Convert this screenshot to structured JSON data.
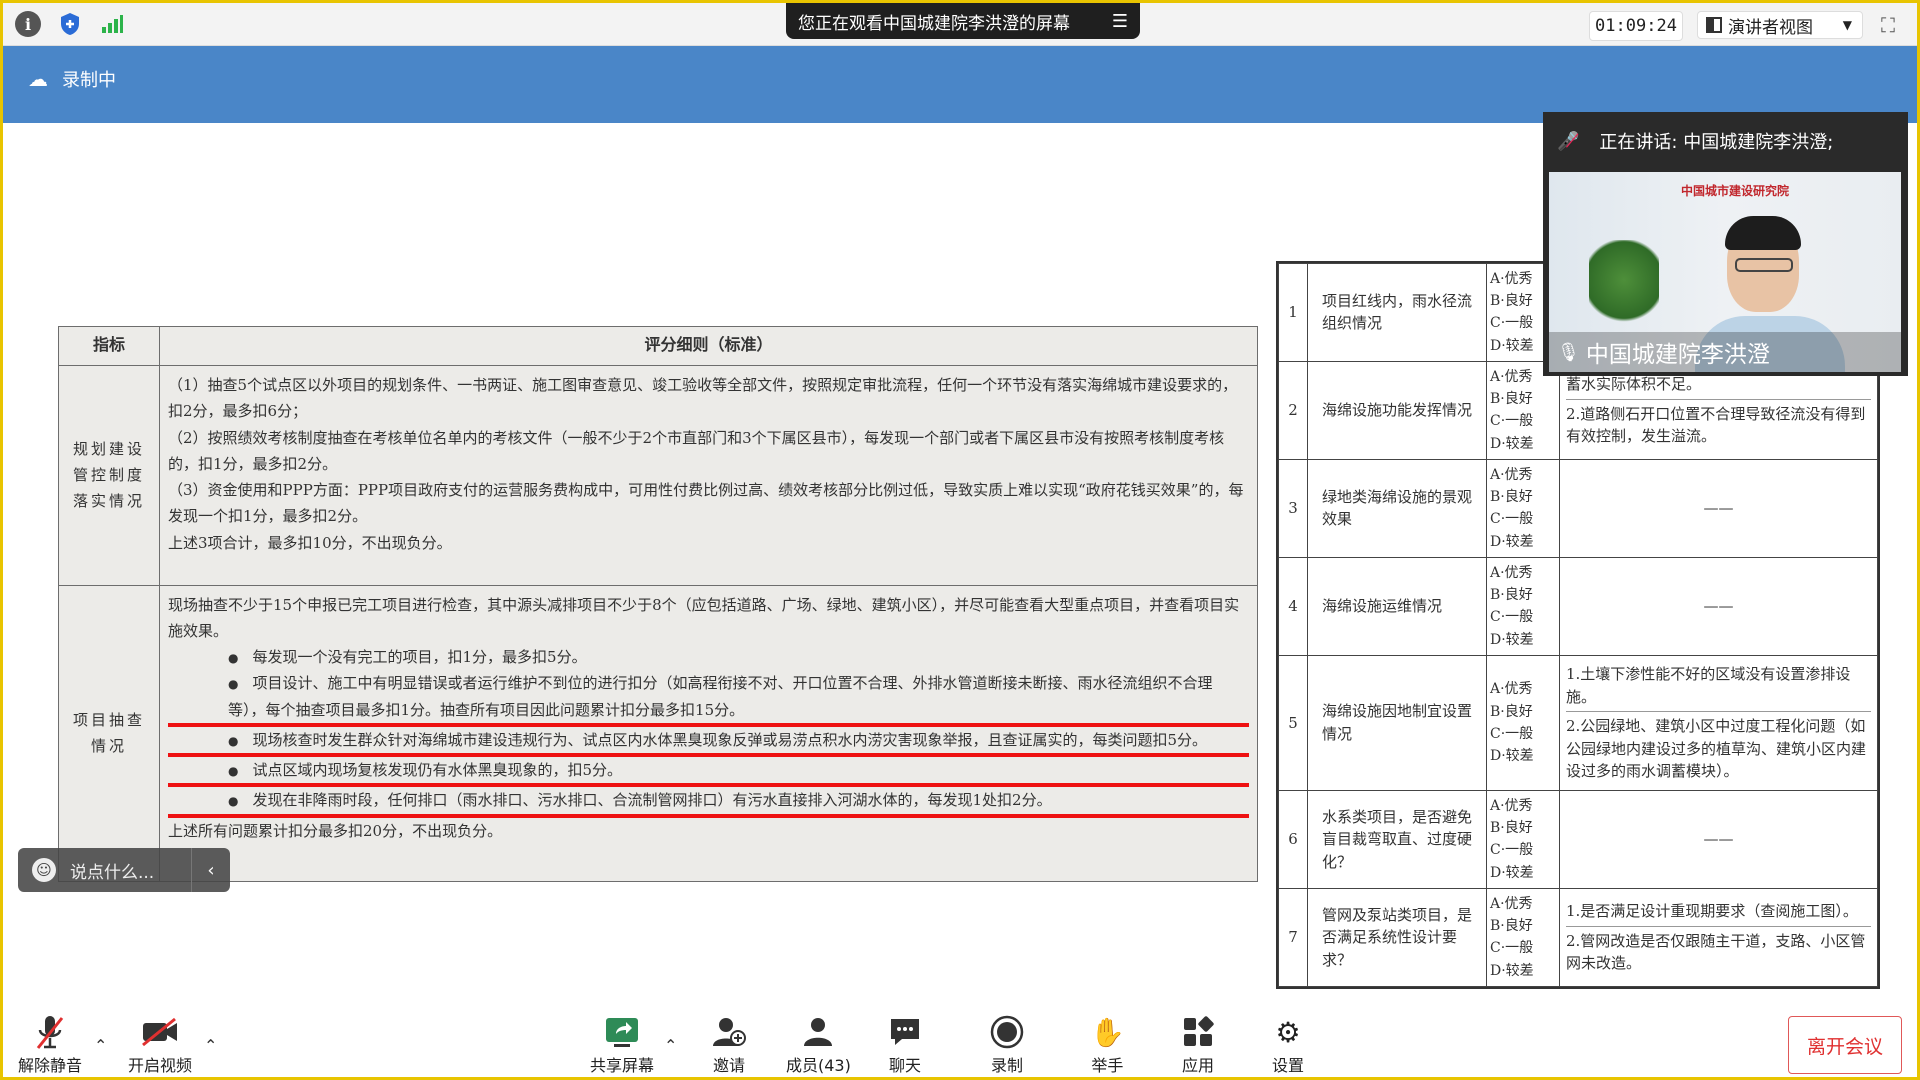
{
  "topbar": {
    "viewing_text": "您正在观看中国城建院李洪澄的屏幕",
    "timer": "01:09:24",
    "view_mode": "演讲者视图"
  },
  "recording": {
    "label": "录制中"
  },
  "slide": {
    "col_headers": [
      "指标",
      "评分细则（标准）"
    ],
    "rows": [
      {
        "category": "规划建设管控制度落实情况",
        "lines": [
          "（1）抽查5个试点区以外项目的规划条件、一书两证、施工图审查意见、竣工验收等全部文件，按照规定审批流程，任何一个环节没有落实海绵城市建设要求的，扣2分，最多扣6分；",
          "（2）按照绩效考核制度抽查在考核单位名单内的考核文件（一般不少于2个市直部门和3个下属区县市），每发现一个部门或者下属区县市没有按照考核制度考核的，扣1分，最多扣2分。",
          "（3）资金使用和PPP方面：PPP项目政府支付的运营服务费构成中，可用性付费比例过高、绩效考核部分比例过低，导致实质上难以实现“政府花钱买效果”的，每发现一个扣1分，最多扣2分。",
          "上述3项合计，最多扣10分，不出现负分。"
        ]
      },
      {
        "category": "项目抽查情况",
        "intro": "现场抽查不少于15个申报已完工项目进行检查，其中源头减排项目不少于8个（应包括道路、广场、绿地、建筑小区），并尽可能查看大型重点项目，并查看项目实施效果。",
        "bullets": [
          "每发现一个没有完工的项目，扣1分，最多扣5分。",
          "项目设计、施工中有明显错误或者运行维护不到位的进行扣分（如高程衔接不对、开口位置不合理、外排水管道断接未断接、雨水径流组织不合理等），每个抽查项目最多扣1分。抽查所有项目因此问题累计扣分最多扣15分。",
          "现场核查时发生群众针对海绵城市建设违规行为、试点区内水体黑臭现象反弹或易涝点积水内涝灾害现象举报，且查证属实的，每类问题扣5分。",
          "试点区域内现场复核发现仍有水体黑臭现象的，扣5分。",
          "发现在非降雨时段，任何排口（雨水排口、污水排口、合流制管网排口）有污水直接排入河湖水体的，每发现1处扣2分。"
        ],
        "footer": "上述所有问题累计扣分最多扣20分，不出现负分。"
      }
    ]
  },
  "score_table": {
    "rows": [
      {
        "no": "1",
        "item": "项目红线内，雨水径流组织情况",
        "grades": [
          "A·优秀",
          "B·良好",
          "C·一般",
          "D·较差"
        ],
        "details": []
      },
      {
        "no": "2",
        "item": "海绵设施功能发挥情况",
        "grades": [
          "A·优秀",
          "B·良好",
          "C·一般",
          "D·较差"
        ],
        "details": [
          "蓄水实际体积不足。",
          "2.道路侧石开口位置不合理导致径流没有得到有效控制，发生溢流。"
        ]
      },
      {
        "no": "3",
        "item": "绿地类海绵设施的景观效果",
        "grades": [
          "A·优秀",
          "B·良好",
          "C·一般",
          "D·较差"
        ],
        "details": [
          "——"
        ]
      },
      {
        "no": "4",
        "item": "海绵设施运维情况",
        "grades": [
          "A·优秀",
          "B·良好",
          "C·一般",
          "D·较差"
        ],
        "details": [
          "——"
        ]
      },
      {
        "no": "5",
        "item": "海绵设施因地制宜设置情况",
        "grades": [
          "A·优秀",
          "B·良好",
          "C·一般",
          "D·较差"
        ],
        "details": [
          "1.土壤下渗性能不好的区域没有设置渗排设施。",
          "2.公园绿地、建筑小区中过度工程化问题（如公园绿地内建设过多的植草沟、建筑小区内建设过多的雨水调蓄模块）。"
        ]
      },
      {
        "no": "6",
        "item": "水系类项目，是否避免盲目裁弯取直、过度硬化？",
        "grades": [
          "A·优秀",
          "B·良好",
          "C·一般",
          "D·较差"
        ],
        "details": [
          "——"
        ]
      },
      {
        "no": "7",
        "item": "管网及泵站类项目，是否满足系统性设计要求？",
        "grades": [
          "A·优秀",
          "B·良好",
          "C·一般",
          "D·较差"
        ],
        "details": [
          "1.是否满足设计重现期要求（查阅施工图）。",
          "2.管网改造是否仅跟随主干道，支路、小区管网未改造。"
        ]
      }
    ]
  },
  "video": {
    "speaking_label": "正在讲话: 中国城建院李洪澄;",
    "participant_name": "中国城建院李洪澄",
    "wall_logo": "中国城市建设研究院"
  },
  "chat": {
    "placeholder": "说点什么..."
  },
  "toolbar": {
    "unmute": "解除静音",
    "start_video": "开启视频",
    "share": "共享屏幕",
    "invite": "邀请",
    "members": "成员(43)",
    "chat": "聊天",
    "record": "录制",
    "raise_hand": "举手",
    "apps": "应用",
    "settings": "设置",
    "leave": "离开会议"
  },
  "colors": {
    "accent_blue": "#4a86c8",
    "leave_red": "#e03030",
    "frame_yellow": "#e8c400",
    "underline_red": "#e11"
  }
}
